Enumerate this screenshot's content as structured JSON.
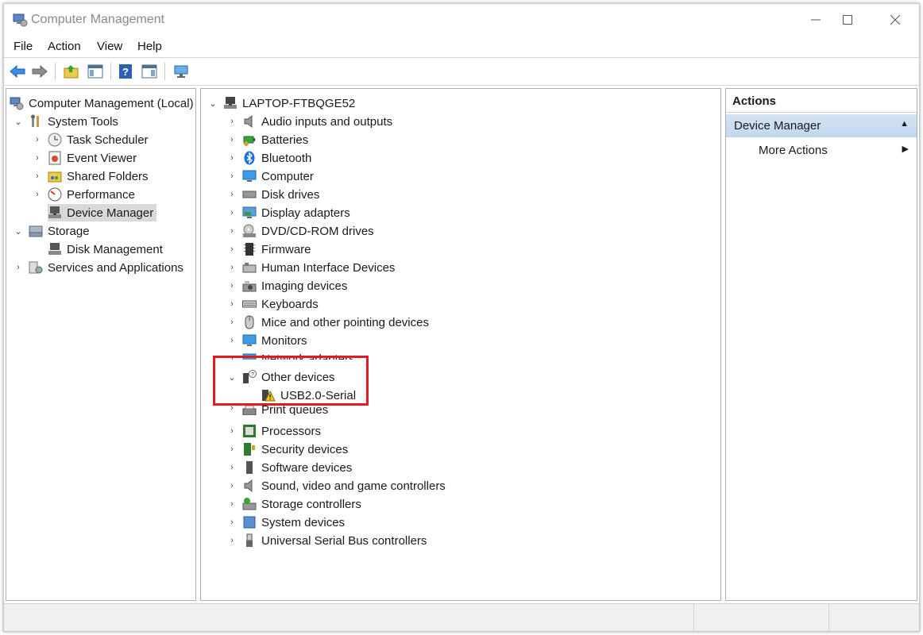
{
  "window": {
    "title": "Computer Management"
  },
  "menu": [
    "File",
    "Action",
    "View",
    "Help"
  ],
  "toolbar": [
    {
      "name": "back-arrow-icon"
    },
    {
      "name": "forward-arrow-icon"
    },
    {
      "name": "up-folder-icon"
    },
    {
      "name": "show-hide-console-tree-icon"
    },
    {
      "name": "help-icon"
    },
    {
      "name": "show-hide-action-pane-icon"
    },
    {
      "name": "scan-hardware-icon"
    }
  ],
  "tree": {
    "root": "Computer Management (Local)",
    "system_tools": "System Tools",
    "task_scheduler": "Task Scheduler",
    "event_viewer": "Event Viewer",
    "shared_folders": "Shared Folders",
    "performance": "Performance",
    "device_manager": "Device Manager",
    "storage": "Storage",
    "disk_management": "Disk Management",
    "services_apps": "Services and Applications"
  },
  "devices": {
    "computer_name": "LAPTOP-FTBQGE52",
    "categories": [
      "Audio inputs and outputs",
      "Batteries",
      "Bluetooth",
      "Computer",
      "Disk drives",
      "Display adapters",
      "DVD/CD-ROM drives",
      "Firmware",
      "Human Interface Devices",
      "Imaging devices",
      "Keyboards",
      "Mice and other pointing devices",
      "Monitors",
      "Network adapters",
      "Other devices",
      "USB2.0-Serial",
      "Print queues",
      "Processors",
      "Security devices",
      "Software devices",
      "Sound, video and game controllers",
      "Storage controllers",
      "System devices",
      "Universal Serial Bus controllers"
    ]
  },
  "actions": {
    "title": "Actions",
    "section": "Device Manager",
    "more": "More Actions"
  },
  "colors": {
    "highlight": "#e01b22",
    "selection": "#d9d9d9",
    "action_header": "#c9dcf0"
  }
}
